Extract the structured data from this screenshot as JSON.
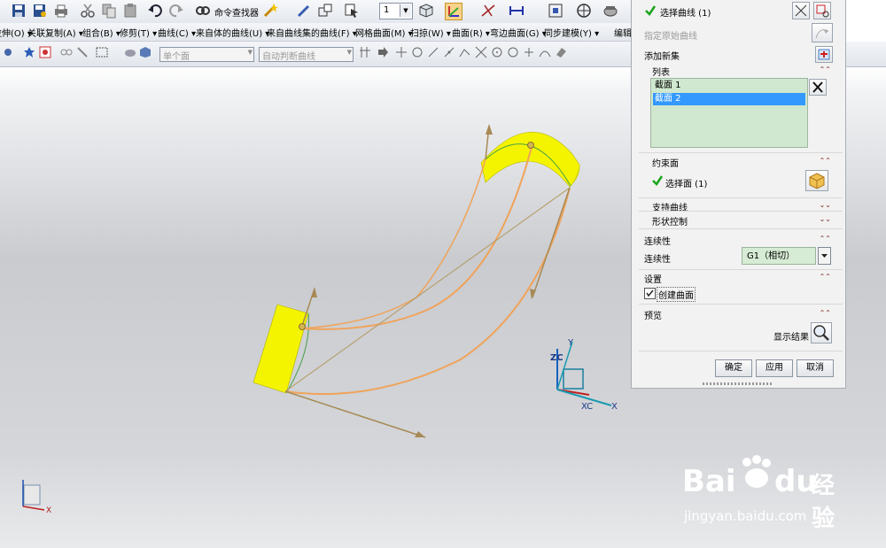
{
  "toolbar": {
    "cmd_finder_label": "命令查找器",
    "layer_value": "1"
  },
  "menu": [
    "拉伸(O) ▾",
    "关联复制(A) ▾",
    "组合(B) ▾",
    "修剪(T) ▾",
    "曲线(C) ▾",
    "来自体的曲线(U) ▾",
    "来自曲线集的曲线(F) ▾",
    "网格曲面(M) ▾",
    "扫掠(W) ▾",
    "曲面(R) ▾",
    "弯边曲面(G) ▾",
    "同步建模(Y) ▾"
  ],
  "menu_edit": "编辑",
  "filters": {
    "face_filter": "单个面",
    "curve_rule": "自动判断曲线"
  },
  "dialog": {
    "select_curve": "选择曲线 (1)",
    "specify_origin": "指定原始曲线",
    "add_new_set": "添加新集",
    "list_title": "列表",
    "list_items": [
      "截面 1",
      "截面 2"
    ],
    "constraint_face": "约束面",
    "select_face": "选择面 (1)",
    "support_curve": "支持曲线",
    "shape_control": "形状控制",
    "continuity_section": "连续性",
    "continuity_label": "连续性",
    "continuity_value": "G1（相切）",
    "settings": "设置",
    "create_surface": "创建曲面",
    "preview": "预览",
    "show_result": "显示结果",
    "ok": "确定",
    "apply": "应用",
    "cancel": "取消"
  },
  "axes": {
    "zc": "ZC",
    "y": "Y",
    "xc": "XC",
    "x": "X",
    "corner_x": "X"
  },
  "watermark": {
    "brand_part1": "Bai",
    "brand_part2": "du",
    "brand_cn": "经验",
    "url": "jingyan.baidu.com"
  },
  "colors": {
    "surface_yellow": "#f4f400",
    "curve_orange": "#f0a35a",
    "vector_tan": "#a88a55",
    "annotation_red": "#d42020",
    "selection_blue": "#3399ff",
    "checkmark_green": "#1aa51a"
  }
}
